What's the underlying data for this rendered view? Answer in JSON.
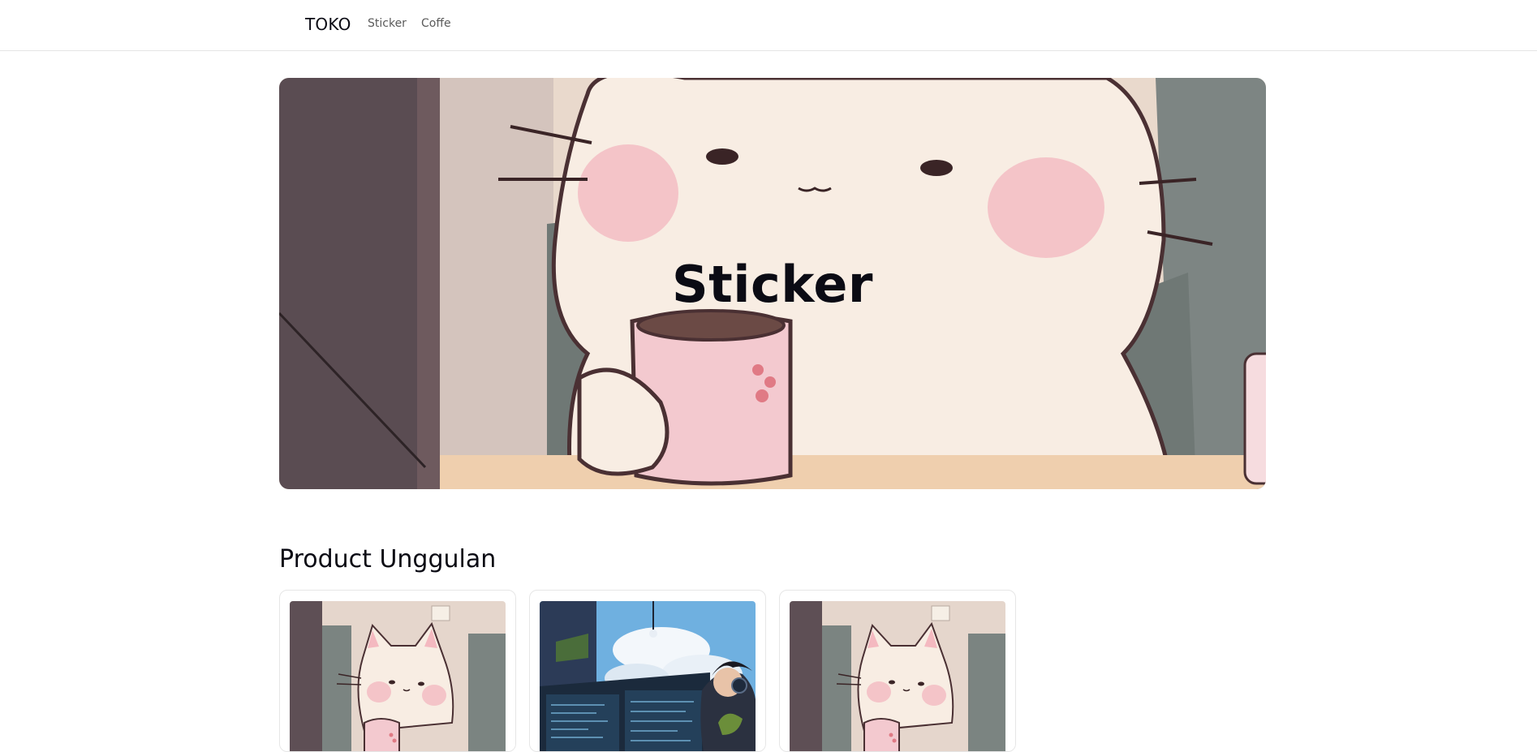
{
  "navbar": {
    "brand": "TOKO",
    "links": [
      {
        "label": "Sticker"
      },
      {
        "label": "Coffe"
      }
    ]
  },
  "hero": {
    "title": "Sticker",
    "image": "cat-with-mug-illustration"
  },
  "featured": {
    "title": "Product Unggulan",
    "products": [
      {
        "image": "cat-with-mug-illustration"
      },
      {
        "image": "programmer-with-headphones-illustration"
      },
      {
        "image": "cat-with-mug-illustration"
      }
    ]
  },
  "colors": {
    "text": "#0b0b14",
    "nav_link": "#5a5a5a",
    "border": "#e5e5e5",
    "cat_body": "#f8ede3",
    "cheek": "#f4c4c8",
    "mug": "#f3c9cf"
  }
}
